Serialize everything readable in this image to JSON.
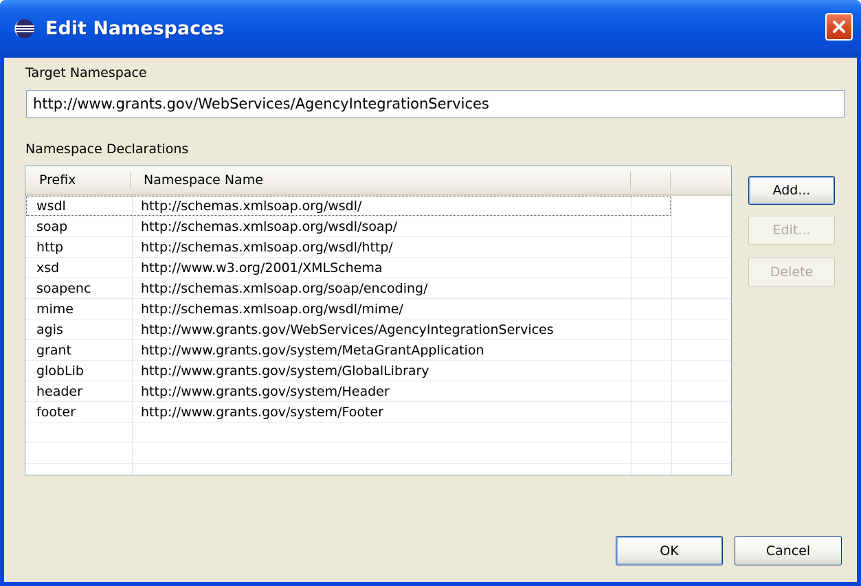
{
  "window": {
    "title": "Edit Namespaces"
  },
  "target": {
    "label": "Target Namespace",
    "value": "http://www.grants.gov/WebServices/AgencyIntegrationServices"
  },
  "declarations": {
    "label": "Namespace Declarations",
    "columns": [
      "Prefix",
      "Namespace Name"
    ],
    "rows": [
      {
        "prefix": "wsdl",
        "name": "http://schemas.xmlsoap.org/wsdl/"
      },
      {
        "prefix": "soap",
        "name": "http://schemas.xmlsoap.org/wsdl/soap/"
      },
      {
        "prefix": "http",
        "name": "http://schemas.xmlsoap.org/wsdl/http/"
      },
      {
        "prefix": "xsd",
        "name": "http://www.w3.org/2001/XMLSchema"
      },
      {
        "prefix": "soapenc",
        "name": "http://schemas.xmlsoap.org/soap/encoding/"
      },
      {
        "prefix": "mime",
        "name": "http://schemas.xmlsoap.org/wsdl/mime/"
      },
      {
        "prefix": "agis",
        "name": "http://www.grants.gov/WebServices/AgencyIntegrationServices"
      },
      {
        "prefix": "grant",
        "name": "http://www.grants.gov/system/MetaGrantApplication"
      },
      {
        "prefix": "globLib",
        "name": "http://www.grants.gov/system/GlobalLibrary"
      },
      {
        "prefix": "header",
        "name": "http://www.grants.gov/system/Header"
      },
      {
        "prefix": "footer",
        "name": "http://www.grants.gov/system/Footer"
      }
    ]
  },
  "side_buttons": {
    "add": "Add...",
    "edit": "Edit...",
    "delete": "Delete"
  },
  "footer_buttons": {
    "ok": "OK",
    "cancel": "Cancel"
  },
  "colors": {
    "titlebar": "#0852dc",
    "face": "#ece9d8",
    "close": "#d6461f"
  },
  "icons": {
    "app": "eclipse-icon",
    "close": "close-icon"
  }
}
